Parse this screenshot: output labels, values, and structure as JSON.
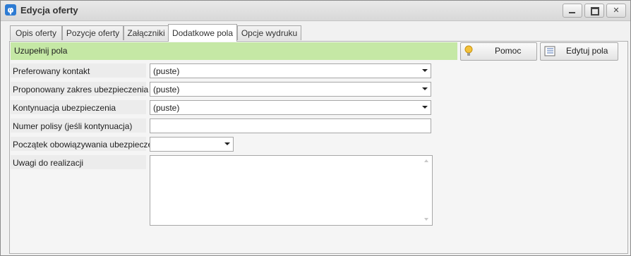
{
  "window": {
    "title": "Edycja oferty",
    "minimize_glyph": "",
    "maximize_glyph": "",
    "close_glyph": "✕"
  },
  "tabs": [
    {
      "label": "Opis oferty",
      "active": false
    },
    {
      "label": "Pozycje oferty",
      "active": false
    },
    {
      "label": "Załączniki",
      "active": false
    },
    {
      "label": "Dodatkowe pola",
      "active": true
    },
    {
      "label": "Opcje wydruku",
      "active": false
    }
  ],
  "banner": {
    "text": "Uzupełnij pola",
    "color": "#c5e8a5"
  },
  "buttons": {
    "help_label": "Pomoc",
    "edit_fields_label": "Edytuj pola"
  },
  "fields": {
    "preferred_contact": {
      "label": "Preferowany kontakt",
      "value": "(puste)"
    },
    "insurance_scope": {
      "label": "Proponowany zakres ubezpieczenia",
      "value": "(puste)"
    },
    "insurance_continuation": {
      "label": "Kontynuacja ubezpieczenia",
      "value": "(puste)"
    },
    "policy_number": {
      "label": "Numer polisy (jeśli kontynuacja)",
      "value": ""
    },
    "insurance_start": {
      "label": "Początek obowiązywania ubezpieczenia",
      "value": ""
    },
    "notes": {
      "label": "Uwagi do realizacji",
      "value": ""
    }
  }
}
